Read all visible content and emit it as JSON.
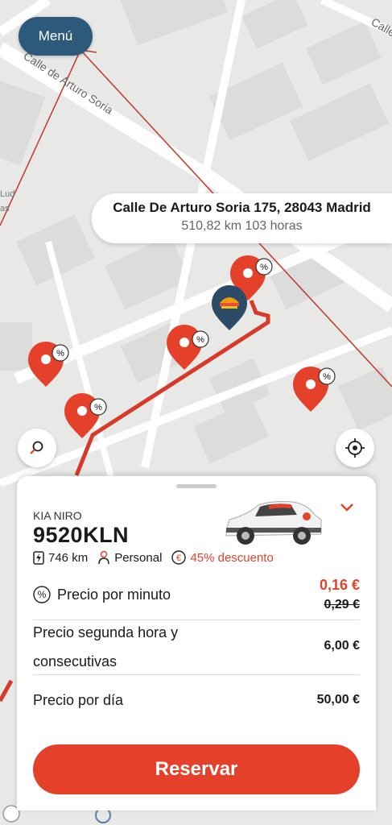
{
  "menu": {
    "label": "Menú"
  },
  "map": {
    "streets": [
      "Calle de Arturo Soria",
      "Calle"
    ],
    "partial_labels": [
      "Lud",
      "as"
    ]
  },
  "address": {
    "title": "Calle De Arturo Soria 175, 28043 Madrid",
    "subtitle": "510,82 km 103 horas"
  },
  "map_controls": {
    "search_icon": "search-icon",
    "locate_icon": "crosshair-icon"
  },
  "vehicle": {
    "model": "KIA NIRO",
    "plate": "9520KLN",
    "range": "746 km",
    "usage": "Personal",
    "discount": "45% descuento"
  },
  "pricing": {
    "per_minute_label": "Precio por minuto",
    "per_minute_price": "0,16 €",
    "per_minute_old_price": "0,29 €",
    "second_hour_label_line1": "Precio segunda hora y",
    "second_hour_label_line2": "consecutivas",
    "second_hour_price": "6,00 €",
    "per_day_label": "Precio por día",
    "per_day_price": "50,00 €"
  },
  "reserve_button": {
    "label": "Reservar"
  },
  "colors": {
    "accent": "#e5412a",
    "menu": "#2d5a7b"
  }
}
